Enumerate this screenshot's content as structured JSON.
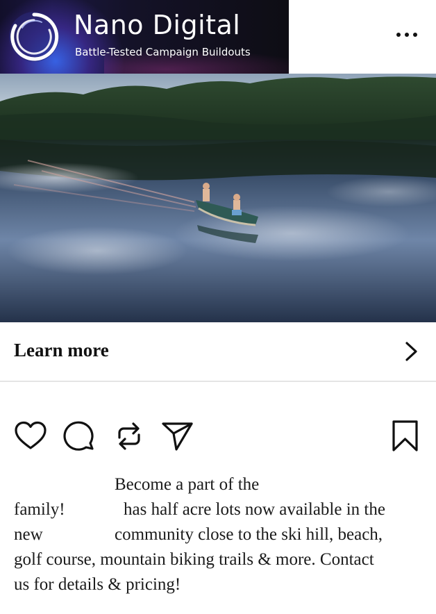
{
  "header": {
    "brand_name": "Nano Digital",
    "tagline": "Battle-Tested Campaign Buildouts",
    "more_icon": "more-horizontal-icon"
  },
  "media": {
    "description_icon": "video-thumbnail"
  },
  "cta": {
    "label": "Learn more",
    "chevron_icon": "chevron-right-icon"
  },
  "actions": {
    "like_icon": "heart-icon",
    "comment_icon": "comment-icon",
    "repost_icon": "repost-icon",
    "share_icon": "send-icon",
    "save_icon": "bookmark-icon"
  },
  "caption": {
    "line1": "Become a part of the",
    "line2_a": "family!",
    "line2_b": "has half acre lots now available in the",
    "line3_a": "new",
    "line3_b": "community close to the ski hill, beach,",
    "line4": "golf course, mountain biking trails & more. Contact",
    "line5": "us for details & pricing!"
  },
  "colors": {
    "brand_bg": "#141228",
    "brand_accent": "#3c6eff",
    "text": "#111111",
    "divider": "#e4e4e4"
  }
}
